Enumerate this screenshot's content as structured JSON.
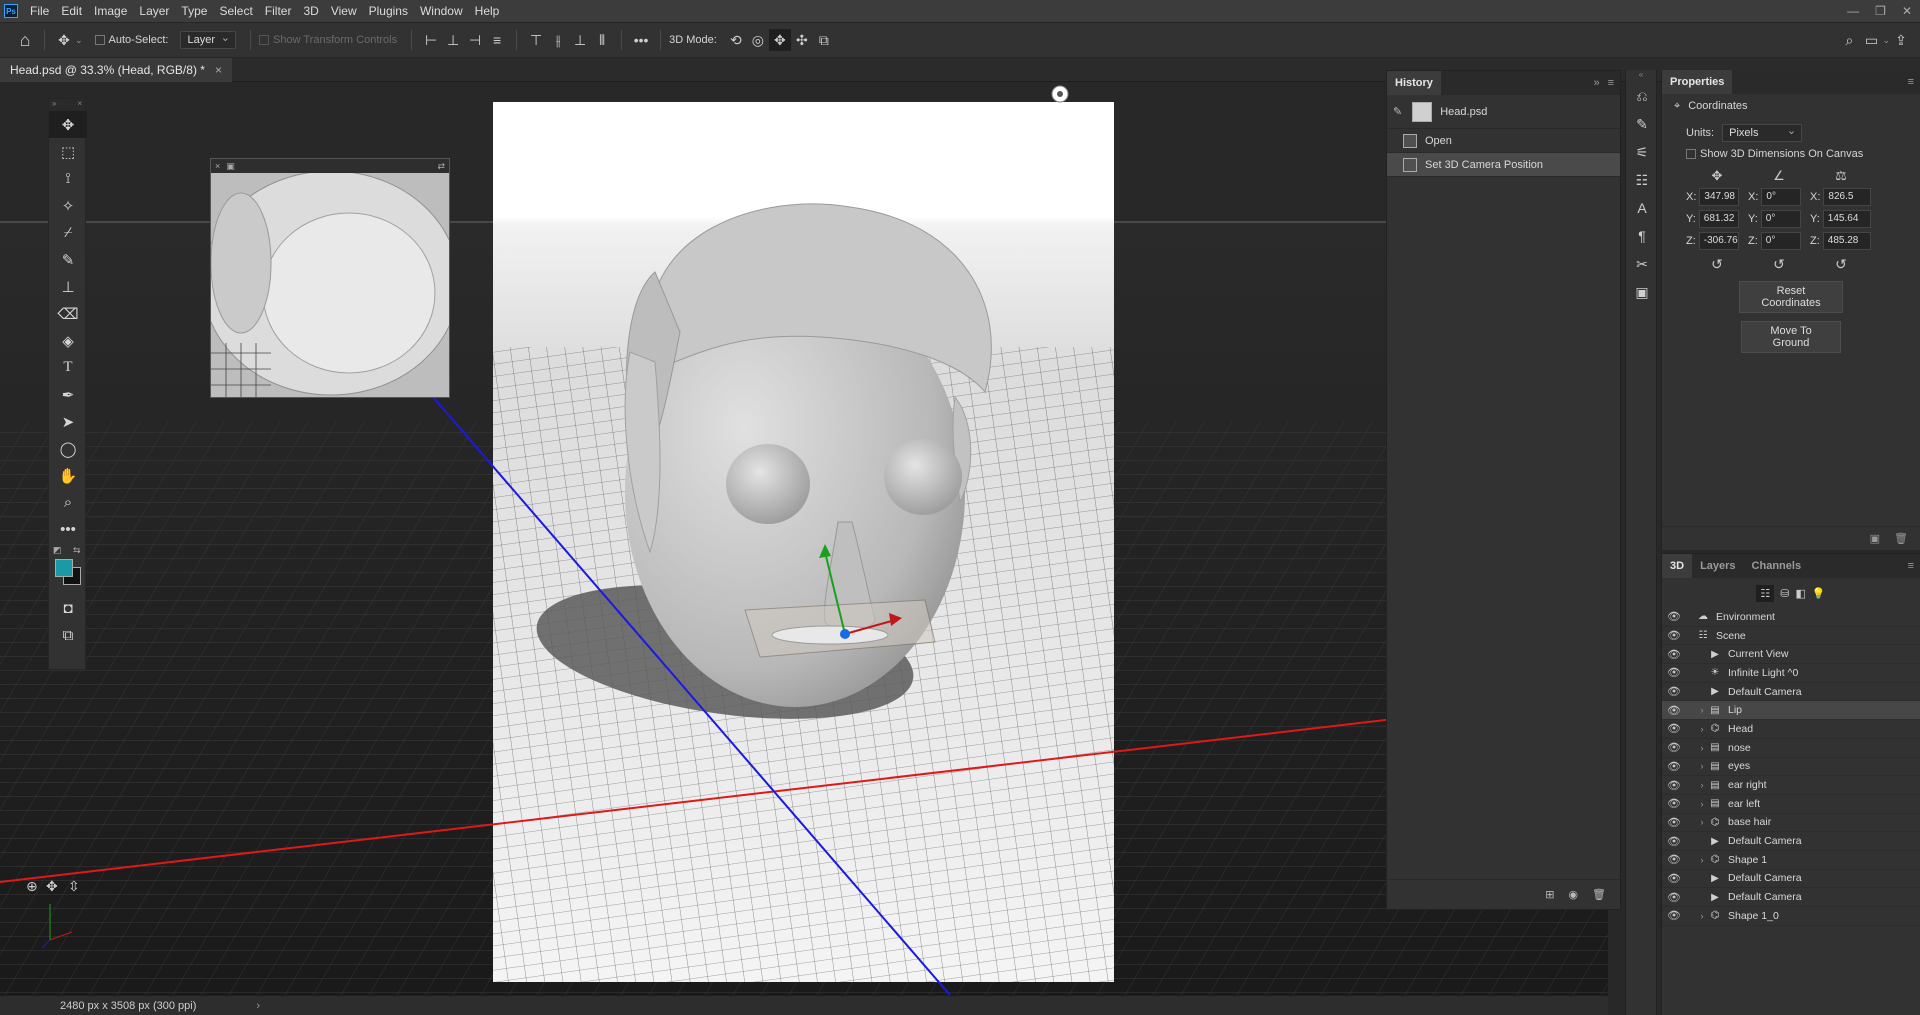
{
  "app": {
    "logo": "Ps"
  },
  "menu": [
    "File",
    "Edit",
    "Image",
    "Layer",
    "Type",
    "Select",
    "Filter",
    "3D",
    "View",
    "Plugins",
    "Window",
    "Help"
  ],
  "window_controls": [
    "—",
    "❐",
    "✕"
  ],
  "options": {
    "auto_select_label": "Auto-Select:",
    "auto_select_value": "Layer",
    "show_transform_label": "Show Transform Controls",
    "mode_label": "3D Mode:"
  },
  "document_tab": {
    "title": "Head.psd @ 33.3% (Head, RGB/8) *",
    "close": "×"
  },
  "status": {
    "dimensions": "2480 px x 3508 px (300 ppi)",
    "arrow": "›"
  },
  "history": {
    "title": "History",
    "snapshot": "Head.psd",
    "items": [
      "Open",
      "Set 3D Camera Position"
    ]
  },
  "properties": {
    "title": "Properties",
    "section": "Coordinates",
    "units_label": "Units:",
    "units_value": "Pixels",
    "show_dims_label": "Show 3D Dimensions On Canvas",
    "position": {
      "x": "347.98",
      "y": "681.32",
      "z": "-306.76"
    },
    "rotation": {
      "x": "0°",
      "y": "0°",
      "z": "0°"
    },
    "scale": {
      "x": "826.5",
      "y": "145.64",
      "z": "485.28"
    },
    "axis_labels": {
      "x": "X:",
      "y": "Y:",
      "z": "Z:"
    },
    "reset_button": "Reset Coordinates",
    "ground_button": "Move To Ground"
  },
  "layers_tabs": [
    "3D",
    "Layers",
    "Channels"
  ],
  "scene_tree": [
    {
      "name": "Environment",
      "icon": "environment-icon",
      "indent": 0,
      "caret": false
    },
    {
      "name": "Scene",
      "icon": "scene-icon",
      "indent": 0,
      "caret": false
    },
    {
      "name": "Current View",
      "icon": "camera-icon",
      "indent": 1,
      "caret": false
    },
    {
      "name": "Infinite Light ^0",
      "icon": "light-icon",
      "indent": 1,
      "caret": false
    },
    {
      "name": "Default Camera",
      "icon": "camera-icon",
      "indent": 1,
      "caret": false
    },
    {
      "name": "Lip",
      "icon": "folder-icon",
      "indent": 1,
      "caret": true,
      "selected": true
    },
    {
      "name": "Head",
      "icon": "mesh-icon",
      "indent": 1,
      "caret": true
    },
    {
      "name": "nose",
      "icon": "folder-icon",
      "indent": 1,
      "caret": true
    },
    {
      "name": "eyes",
      "icon": "folder-icon",
      "indent": 1,
      "caret": true
    },
    {
      "name": "ear right",
      "icon": "folder-icon",
      "indent": 1,
      "caret": true
    },
    {
      "name": "ear left",
      "icon": "folder-icon",
      "indent": 1,
      "caret": true
    },
    {
      "name": "base hair",
      "icon": "mesh-icon",
      "indent": 1,
      "caret": true
    },
    {
      "name": "Default Camera",
      "icon": "camera-icon",
      "indent": 1,
      "caret": false
    },
    {
      "name": "Shape 1",
      "icon": "mesh-icon",
      "indent": 1,
      "caret": true
    },
    {
      "name": "Default Camera",
      "icon": "camera-icon",
      "indent": 1,
      "caret": false
    },
    {
      "name": "Default Camera",
      "icon": "camera-icon",
      "indent": 1,
      "caret": false
    },
    {
      "name": "Shape 1_0",
      "icon": "mesh-icon",
      "indent": 1,
      "caret": true
    }
  ],
  "colors": {
    "foreground": "#1a9aa6",
    "background": "#111111",
    "x_axis": "#e01818",
    "y_axis": "#1a1ae0"
  }
}
